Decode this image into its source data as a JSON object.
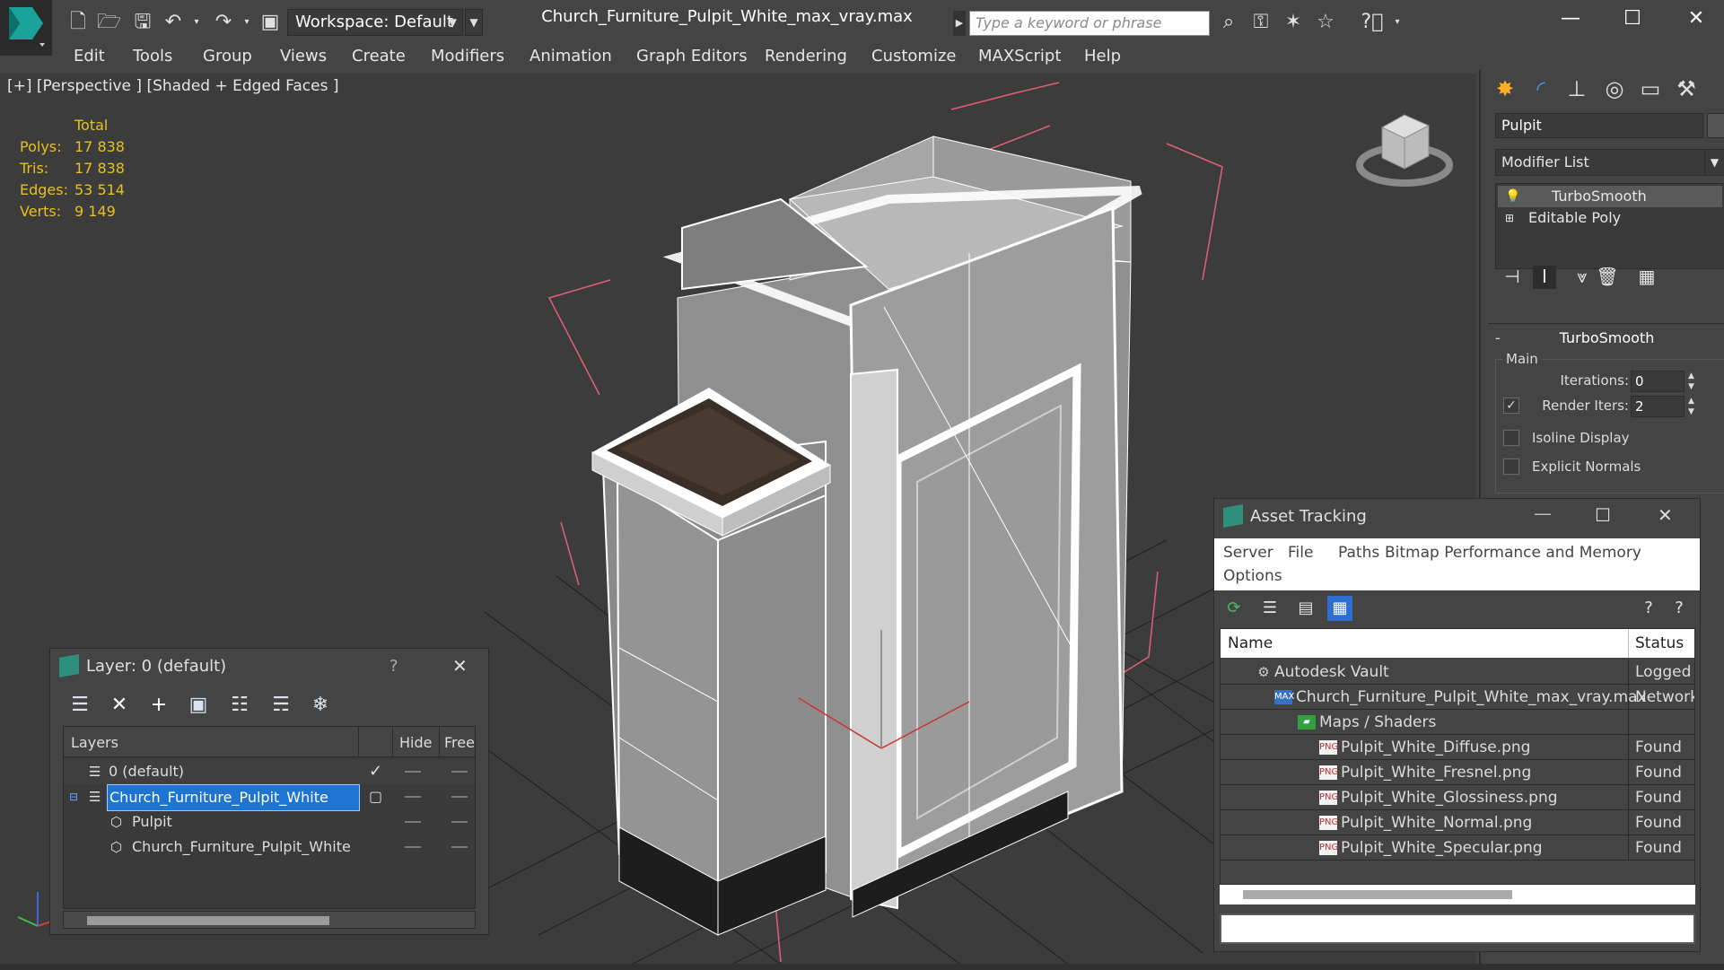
{
  "titlebar": {
    "workspace_label": "Workspace: Default",
    "document_title": "Church_Furniture_Pulpit_White_max_vray.max",
    "search_placeholder": "Type a keyword or phrase"
  },
  "menubar": {
    "items": [
      "Edit",
      "Tools",
      "Group",
      "Views",
      "Create",
      "Modifiers",
      "Animation",
      "Graph Editors",
      "Rendering",
      "Customize",
      "MAXScript",
      "Help"
    ]
  },
  "viewport": {
    "label": "[+] [Perspective ] [Shaded + Edged Faces ]",
    "stats": {
      "header": "Total",
      "rows": [
        {
          "label": "Polys:",
          "value": "17 838"
        },
        {
          "label": "Tris:",
          "value": "17 838"
        },
        {
          "label": "Edges:",
          "value": "53 514"
        },
        {
          "label": "Verts:",
          "value": "9 149"
        }
      ]
    }
  },
  "command_panel": {
    "object_name": "Pulpit",
    "modifier_list": "Modifier List",
    "stack": [
      "TurboSmooth",
      "Editable Poly"
    ],
    "rollout_title": "TurboSmooth",
    "group_label": "Main",
    "iterations_label": "Iterations:",
    "iterations_value": "0",
    "render_iters_label": "Render Iters:",
    "render_iters_value": "2",
    "isoline_label": "Isoline Display",
    "explicit_normals_label": "Explicit Normals"
  },
  "layer_dialog": {
    "title": "Layer: 0 (default)",
    "help": "?",
    "close": "✕",
    "columns": {
      "layers": "Layers",
      "hide": "Hide",
      "freeze": "Freeze"
    },
    "rows": [
      {
        "name": "0 (default)"
      },
      {
        "name": "Church_Furniture_Pulpit_White"
      },
      {
        "name": "Pulpit"
      },
      {
        "name": "Church_Furniture_Pulpit_White"
      }
    ]
  },
  "asset_dialog": {
    "title": "Asset Tracking",
    "menu": [
      "Server",
      "File",
      "Paths",
      "Bitmap Performance and Memory",
      "Options"
    ],
    "columns": {
      "name": "Name",
      "status": "Status"
    },
    "rows": [
      {
        "name": "Autodesk Vault",
        "status": "Logged Out"
      },
      {
        "name": "Church_Furniture_Pulpit_White_max_vray.max",
        "status": "Network"
      },
      {
        "name": "Maps / Shaders",
        "status": ""
      },
      {
        "name": "Pulpit_White_Diffuse.png",
        "status": "Found"
      },
      {
        "name": "Pulpit_White_Fresnel.png",
        "status": "Found"
      },
      {
        "name": "Pulpit_White_Glossiness.png",
        "status": "Found"
      },
      {
        "name": "Pulpit_White_Normal.png",
        "status": "Found"
      },
      {
        "name": "Pulpit_White_Specular.png",
        "status": "Found"
      }
    ]
  },
  "colors": {
    "ui_bg": "#444444",
    "viewport_bg": "#3c3c3c",
    "stats": "#e8c020",
    "selection": "#1e74d0",
    "bounding_box": "#e0607a"
  }
}
